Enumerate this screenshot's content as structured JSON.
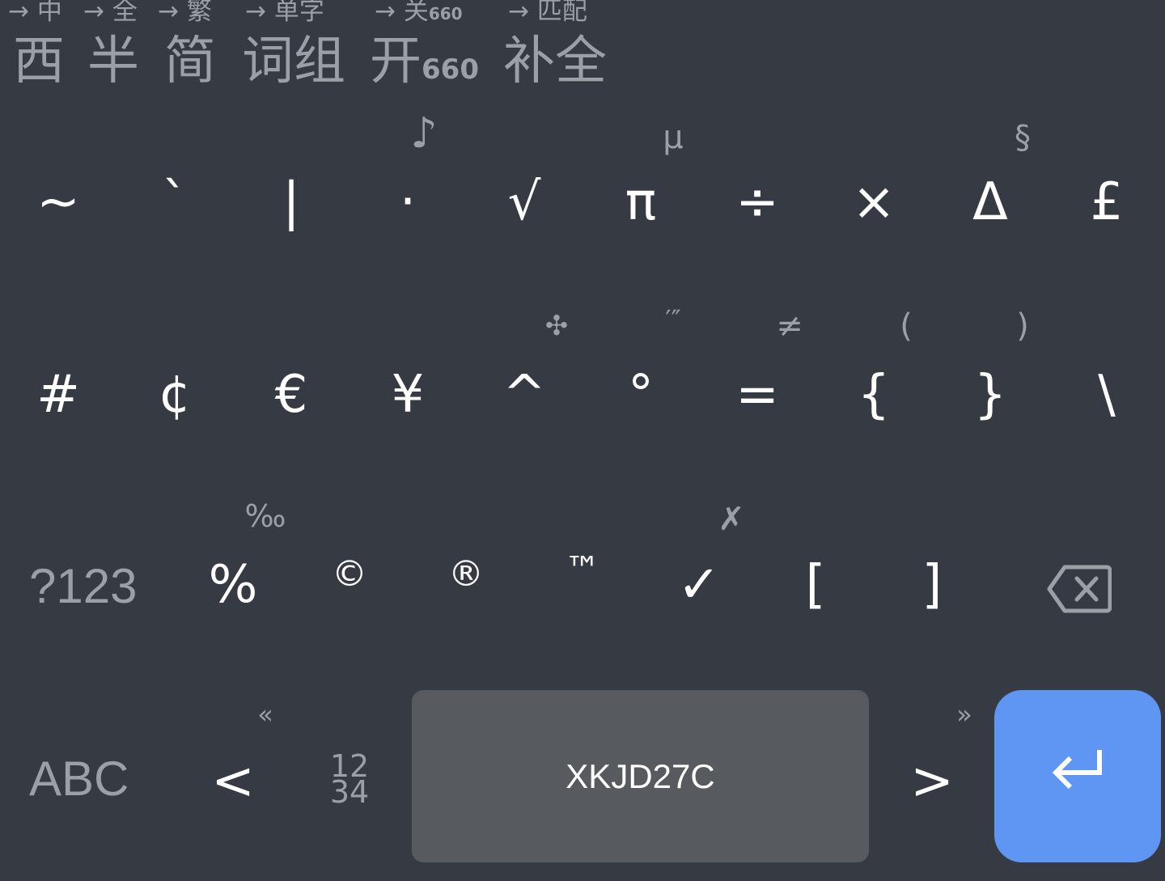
{
  "toolbar": {
    "items": [
      {
        "hint": "→ 中",
        "label": "西"
      },
      {
        "hint": "→ 全",
        "label": "半"
      },
      {
        "hint": "→ 繁",
        "label": "简"
      },
      {
        "hint": "→ 单字",
        "label": "词组"
      },
      {
        "hint_prefix": "→ 关",
        "hint_sub": "660",
        "label_prefix": "开",
        "label_sub": "660"
      },
      {
        "hint": "→ 匹配",
        "label": "补全"
      }
    ]
  },
  "rows": {
    "row1": [
      {
        "key": "~",
        "alt": ""
      },
      {
        "key": "`",
        "alt": ""
      },
      {
        "key": "|",
        "alt": ""
      },
      {
        "key": "·",
        "alt": "♪"
      },
      {
        "key": "√",
        "alt": ""
      },
      {
        "key": "π",
        "alt": "µ"
      },
      {
        "key": "÷",
        "alt": ""
      },
      {
        "key": "×",
        "alt": ""
      },
      {
        "key": "Δ",
        "alt": "§"
      },
      {
        "key": "£",
        "alt": ""
      }
    ],
    "row2": [
      {
        "key": "#",
        "alt": ""
      },
      {
        "key": "¢",
        "alt": ""
      },
      {
        "key": "€",
        "alt": ""
      },
      {
        "key": "¥",
        "alt": ""
      },
      {
        "key": "^",
        "alt": "✣"
      },
      {
        "key": "°",
        "alt": "′″"
      },
      {
        "key": "=",
        "alt": "≠"
      },
      {
        "key": "{",
        "alt": "("
      },
      {
        "key": "}",
        "alt": ")"
      },
      {
        "key": "\\",
        "alt": ""
      }
    ],
    "row3": [
      {
        "key": "?123",
        "alt": ""
      },
      {
        "key": "%",
        "alt": "‰"
      },
      {
        "key": "©",
        "alt": ""
      },
      {
        "key": "®",
        "alt": ""
      },
      {
        "key": "™",
        "alt": ""
      },
      {
        "key": "✓",
        "alt": "✗"
      },
      {
        "key": "[",
        "alt": ""
      },
      {
        "key": "]",
        "alt": ""
      }
    ],
    "row4": {
      "abc": "ABC",
      "left": {
        "key": "<",
        "alt": "«"
      },
      "numpad_top": "12",
      "numpad_bottom": "34",
      "space": "XKJD27C",
      "right": {
        "key": ">",
        "alt": "»"
      }
    }
  },
  "colors": {
    "background": "#363a42",
    "space_key": "#575a5f",
    "enter_key": "#5f96f3",
    "secondary_text": "#9aa0a6",
    "primary_text": "#ffffff"
  },
  "icons": {
    "backspace": "backspace-icon",
    "enter": "enter-arrow-icon"
  }
}
